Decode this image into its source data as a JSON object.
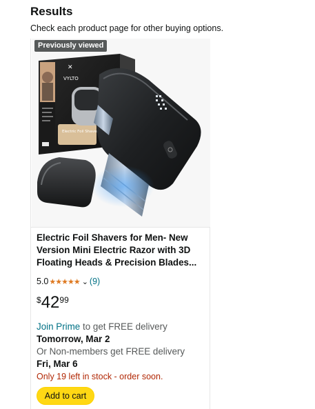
{
  "header": {
    "title": "Results",
    "subtitle": "Check each product page for other buying options."
  },
  "product": {
    "badge": "Previously viewed",
    "box_brand": "VYLTO",
    "box_label": "Electric Foil Shaver",
    "title": "Electric Foil Shavers for Men- New Version Mini Electric Razor with 3D Floating Heads & Precision Blades...",
    "rating_value": "5.0",
    "stars": "★★★★★",
    "rating_chevron": "⌄",
    "review_count": "(9)",
    "price": {
      "symbol": "$",
      "whole": "42",
      "fraction": "99"
    },
    "prime_link": "Join Prime",
    "prime_text": " to get FREE delivery",
    "prime_date": "Tomorrow, Mar 2",
    "nonmember_text": "Or Non-members get FREE delivery",
    "nonmember_date": "Fri, Mar 6",
    "stock": "Only 19 left in stock - order soon.",
    "add_to_cart": "Add to cart"
  },
  "colors": {
    "accent_link": "#007185",
    "star": "#de7921",
    "stock_red": "#b12704",
    "cart_button": "#ffd814"
  }
}
